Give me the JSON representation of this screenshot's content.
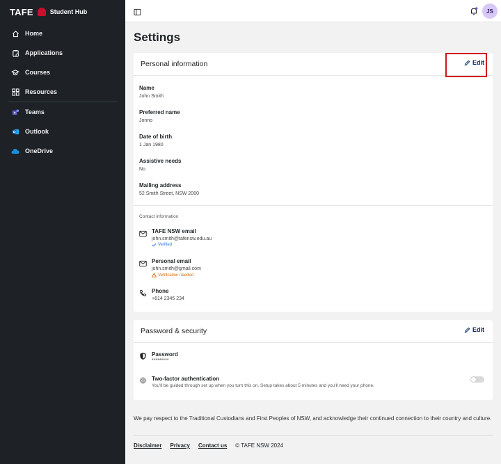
{
  "brand": {
    "logo_text": "TAFE",
    "app_title": "Student Hub"
  },
  "sidebar": {
    "items": [
      {
        "label": "Home",
        "icon": "home-icon"
      },
      {
        "label": "Applications",
        "icon": "clipboard-icon"
      },
      {
        "label": "Courses",
        "icon": "graduation-cap-icon"
      },
      {
        "label": "Resources",
        "icon": "grid-icon"
      },
      {
        "label": "Teams",
        "icon": "teams-icon"
      },
      {
        "label": "Outlook",
        "icon": "outlook-icon"
      },
      {
        "label": "OneDrive",
        "icon": "onedrive-icon"
      }
    ]
  },
  "topbar": {
    "avatar_initials": "JS"
  },
  "page": {
    "title": "Settings"
  },
  "personal": {
    "heading": "Personal information",
    "edit_label": "Edit",
    "fields": [
      {
        "label": "Name",
        "value": "John Smith"
      },
      {
        "label": "Preferred name",
        "value": "Jonno"
      },
      {
        "label": "Date of birth",
        "value": "1 Jan 1980"
      },
      {
        "label": "Assistive needs",
        "value": "No"
      },
      {
        "label": "Mailing address",
        "value": "52 Smith Street, NSW 2000"
      }
    ],
    "contact_caption": "Contact information",
    "contacts": [
      {
        "label": "TAFE NSW email",
        "value": "john.smith@tafensw.edu.au",
        "status": "Verified"
      },
      {
        "label": "Personal email",
        "value": "john.smith@gmail.com",
        "status": "Verification needed"
      },
      {
        "label": "Phone",
        "value": "+614 2345 234"
      }
    ]
  },
  "security": {
    "heading": "Password & security",
    "edit_label": "Edit",
    "password_label": "Password",
    "password_value": "*********",
    "twofa_label": "Two-factor authentication",
    "twofa_desc": "You'll be guided through set up when you turn this on. Setup takes about 5 minutes and you'll need your phone.",
    "twofa_enabled": false
  },
  "acknowledgement": "We pay respect to the Traditional Custodians and First Peoples of NSW, and acknowledge their continued connection to their country and culture.",
  "footer": {
    "links": [
      "Disclaimer",
      "Privacy",
      "Contact us"
    ],
    "copyright": "© TAFE NSW 2024"
  },
  "colors": {
    "sidebar_bg": "#1e2227",
    "accent": "#0b2e6b",
    "highlight": "#d3121b",
    "verified": "#2c6fd6",
    "warning": "#d46b08"
  }
}
